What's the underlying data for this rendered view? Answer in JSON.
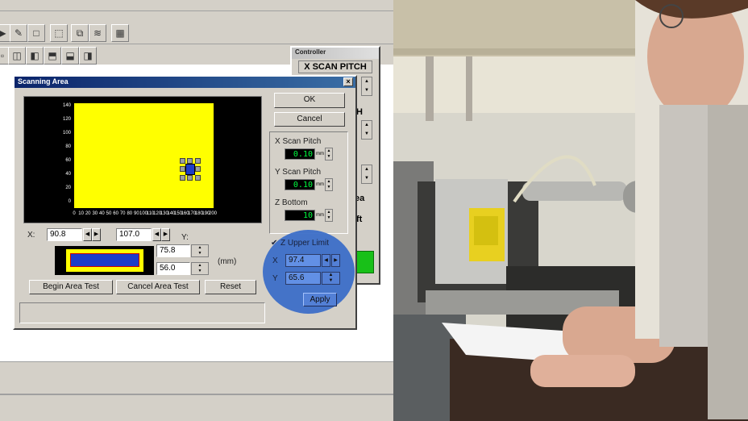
{
  "controller": {
    "title": "Controller",
    "scan_pitch_label": "X SCAN PITCH",
    "partial_h": "H",
    "partial_ea": "ea",
    "partial_ft": "ft"
  },
  "dialog": {
    "title": "Scanning Area",
    "close": "×",
    "ok": "OK",
    "cancel": "Cancel",
    "x_scan_pitch_label": "X Scan Pitch",
    "x_scan_pitch_value": "0.10",
    "y_scan_pitch_label": "Y Scan Pitch",
    "y_scan_pitch_value": "0.10",
    "z_bottom_label": "Z Bottom",
    "z_bottom_value": "10",
    "unit_mm": "mm",
    "x_label": "X:",
    "x_start": "90.8",
    "x_end": "107.0",
    "y_label": "Y:",
    "y_start": "75.8",
    "y_end": "56.0",
    "mm_label": "(mm)",
    "begin_test": "Begin Area Test",
    "cancel_test": "Cancel Area Test",
    "reset": "Reset",
    "z_upper_label": "Z Upper Limit",
    "z_upper_checked": "✔",
    "upper_x_label": "X",
    "upper_x_value": "97.4",
    "upper_y_label": "Y",
    "upper_y_value": "65.6",
    "apply": "Apply"
  },
  "plot": {
    "y_ticks": [
      "140",
      "120",
      "100",
      "80",
      "60",
      "40",
      "20",
      "0"
    ],
    "x_ticks": [
      "0",
      "10",
      "20",
      "30",
      "40",
      "50",
      "60",
      "70",
      "80",
      "90",
      "100",
      "110",
      "120",
      "130",
      "140",
      "150",
      "160",
      "170",
      "180",
      "190",
      "200"
    ]
  }
}
